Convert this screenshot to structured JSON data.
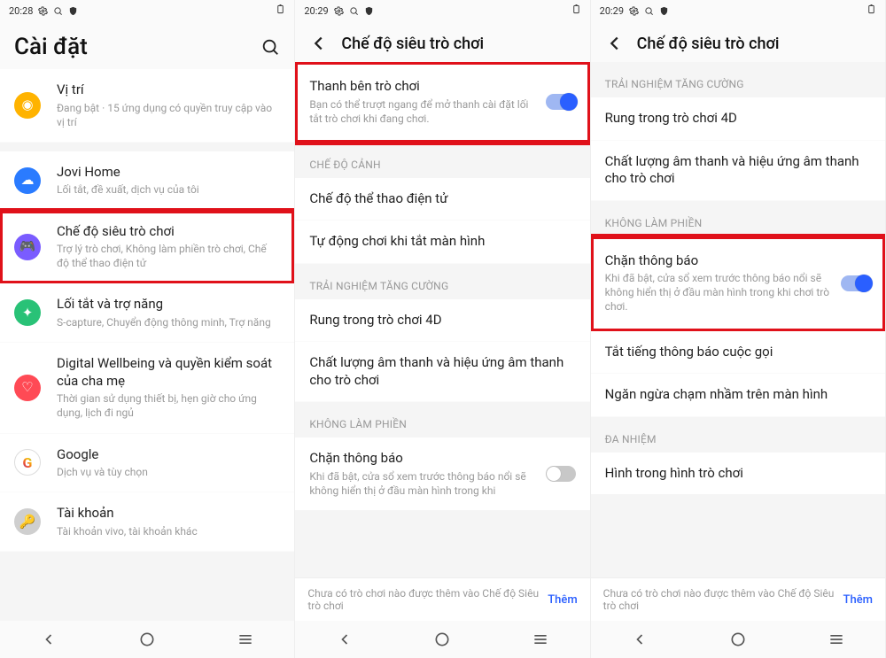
{
  "panel1": {
    "status": {
      "time": "20:28"
    },
    "title": "Cài đặt",
    "items": [
      {
        "title": "Vị trí",
        "sub": "Đang bật · 15 ứng dụng có quyền truy cập vào vị trí",
        "icon": "location",
        "color": "c-orange"
      },
      {
        "title": "Jovi Home",
        "sub": "Lối tắt, đề xuất, dịch vụ của tôi",
        "icon": "jovi",
        "color": "c-blue"
      },
      {
        "title": "Chế độ siêu trò chơi",
        "sub": "Trợ lý trò chơi, Không làm phiền trò chơi, Chế độ thể thao điện tử",
        "icon": "game",
        "color": "c-purple"
      },
      {
        "title": "Lối tắt và trợ năng",
        "sub": "S-capture, Chuyển động thông minh, Trợ năng",
        "icon": "accessibility",
        "color": "c-green"
      },
      {
        "title": "Digital Wellbeing và quyền kiểm soát của cha mẹ",
        "sub": "Thời gian sử dụng thiết bị, hẹn giờ cho ứng dụng, lịch đi ngủ",
        "icon": "wellbeing",
        "color": "c-red"
      },
      {
        "title": "Google",
        "sub": "Dịch vụ và tùy chọn",
        "icon": "google",
        "color": ""
      },
      {
        "title": "Tài khoản",
        "sub": "Tài khoản vivo, tài khoản khác",
        "icon": "account",
        "color": "c-grey"
      }
    ]
  },
  "panel2": {
    "status": {
      "time": "20:29"
    },
    "title": "Chế độ siêu trò chơi",
    "top_toggle": {
      "title": "Thanh bên trò chơi",
      "sub": "Bạn có thể trượt ngang để mở thanh cài đặt lối tắt trò chơi khi đang chơi.",
      "on": true
    },
    "sections": [
      {
        "header": "CHẾ ĐỘ CẢNH",
        "rows": [
          {
            "title": "Chế độ thể thao điện tử"
          },
          {
            "title": "Tự động chơi khi tắt màn hình"
          }
        ]
      },
      {
        "header": "TRẢI NGHIỆM TĂNG CƯỜNG",
        "rows": [
          {
            "title": "Rung trong trò chơi 4D"
          },
          {
            "title": "Chất lượng âm thanh và hiệu ứng âm thanh cho trò chơi"
          }
        ]
      },
      {
        "header": "KHÔNG LÀM PHIỀN",
        "rows": [
          {
            "title": "Chặn thông báo",
            "sub": "Khi đã bật, cửa sổ xem trước thông báo nổi sẽ không hiển thị ở đầu màn hình trong khi",
            "toggle": false
          }
        ]
      }
    ],
    "hint": {
      "text": "Chưa có trò chơi nào được thêm vào Chế độ Siêu trò chơi",
      "add": "Thêm"
    }
  },
  "panel3": {
    "status": {
      "time": "20:29"
    },
    "title": "Chế độ siêu trò chơi",
    "sections": [
      {
        "header": "TRẢI NGHIỆM TĂNG CƯỜNG",
        "rows": [
          {
            "title": "Rung trong trò chơi 4D"
          },
          {
            "title": "Chất lượng âm thanh và hiệu ứng âm thanh cho trò chơi"
          }
        ]
      },
      {
        "header": "KHÔNG LÀM PHIỀN",
        "rows": [
          {
            "title": "Chặn thông báo",
            "sub": "Khi đã bật, cửa sổ xem trước thông báo nổi sẽ không hiển thị ở đầu màn hình trong khi chơi trò chơi.",
            "toggle": true,
            "highlight": true
          },
          {
            "title": "Tắt tiếng thông báo cuộc gọi"
          },
          {
            "title": "Ngăn ngừa chạm nhầm trên màn hình"
          }
        ]
      },
      {
        "header": "ĐA NHIỆM",
        "rows": [
          {
            "title": "Hình trong hình trò chơi"
          }
        ]
      }
    ],
    "hint": {
      "text": "Chưa có trò chơi nào được thêm vào Chế độ Siêu trò chơi",
      "add": "Thêm"
    }
  }
}
